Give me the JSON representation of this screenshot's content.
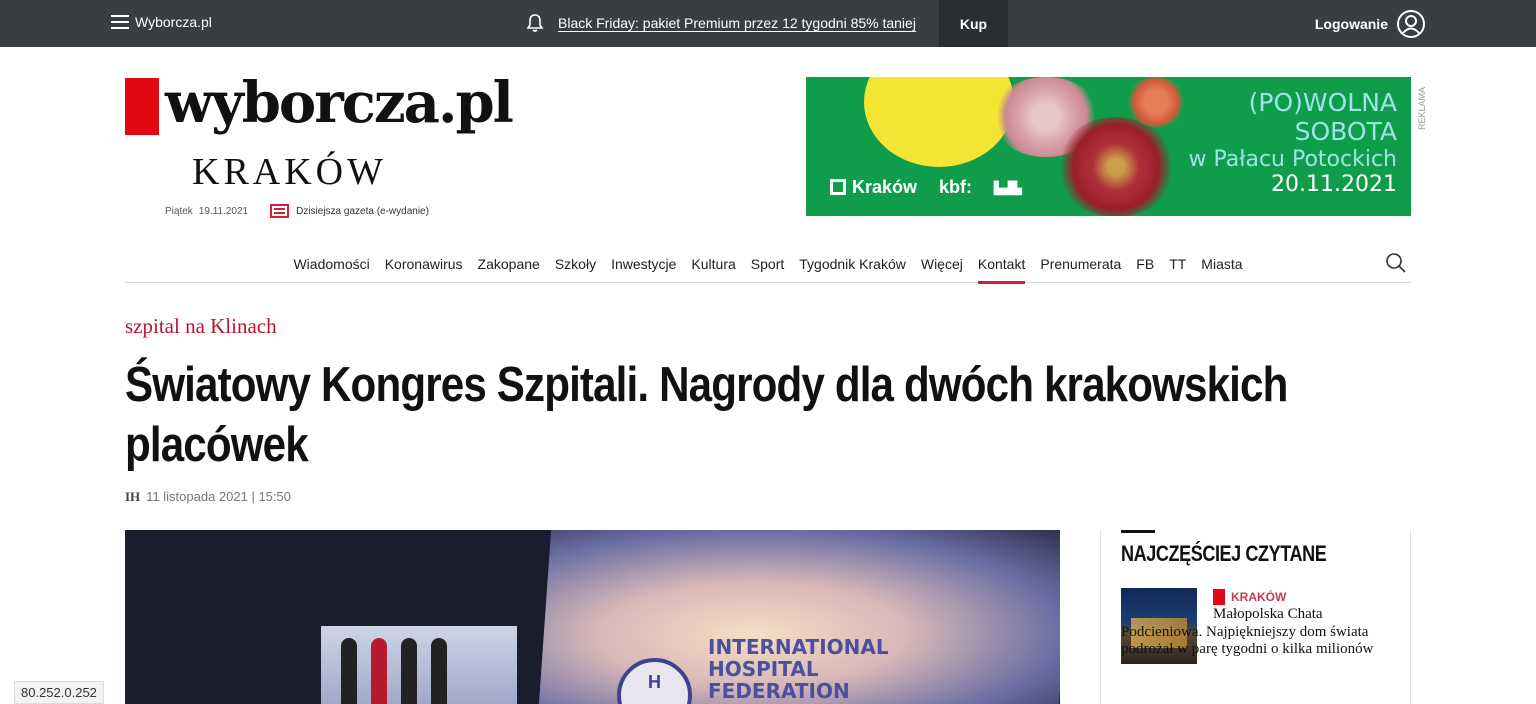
{
  "topbar": {
    "menu_label": "Wyborcza.pl",
    "promo_text": "Black Friday: pakiet Premium przez 12 tygodni 85% taniej",
    "buy_label": "Kup",
    "login_label": "Logowanie"
  },
  "header": {
    "logo_text": "wyborcza.pl",
    "city": "KRAKÓW",
    "day": "Piątek",
    "date": "19.11.2021",
    "paper_link": "Dzisiejsza gazeta (e-wydanie)"
  },
  "ad": {
    "line1": "(PO)WOLNA",
    "line2": "SOBOTA",
    "line3": "w Pałacu Potockich",
    "line4": "20.11.2021",
    "logo1": "Kraków",
    "logo2": "kbf:",
    "label": "REKLAMA"
  },
  "nav": {
    "items": [
      "Wiadomości",
      "Koronawirus",
      "Zakopane",
      "Szkoły",
      "Inwestycje",
      "Kultura",
      "Sport",
      "Tygodnik Kraków",
      "Więcej",
      "Kontakt",
      "Prenumerata",
      "FB",
      "TT",
      "Miasta"
    ],
    "active_item": "Kontakt"
  },
  "article": {
    "kicker": "szpital na Klinach",
    "title": "Światowy Kongres Szpitali. Nagrody dla dwóch krakowskich placówek",
    "author": "IH",
    "date": "11 listopada 2021 | 15:50",
    "photo_text_1": "INTERNATIONAL",
    "photo_text_2": "HOSPITAL",
    "photo_text_3": "FEDERATION"
  },
  "sidebar": {
    "heading": "NAJCZĘŚCIEJ CZYTANE",
    "item_tag": "KRAKÓW",
    "item_headline": "Małopolska Chata Podcieniowa. Najpiękniejszy dom świata podrożał w parę tygodni o kilka milionów"
  },
  "footer": {
    "ip": "80.252.0.252"
  }
}
